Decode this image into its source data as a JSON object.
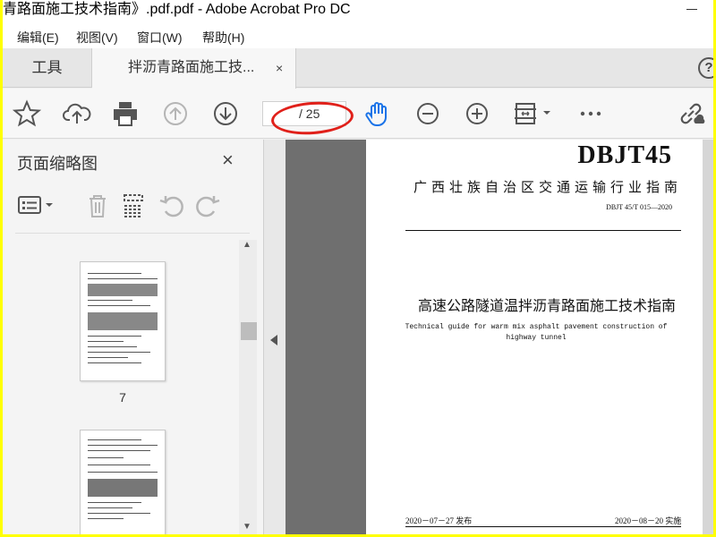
{
  "window": {
    "title": "青路面施工技术指南》.pdf.pdf - Adobe Acrobat Pro DC"
  },
  "menu": [
    "编辑(E)",
    "视图(V)",
    "窗口(W)",
    "帮助(H)"
  ],
  "tabs": {
    "tools": "工具",
    "document": "拌沥青路面施工技...",
    "close": "×",
    "help": "?"
  },
  "toolbar": {
    "page_current": "",
    "page_total": "/ 25",
    "icons": [
      "star-icon",
      "upload-icon",
      "print-icon",
      "page-up-icon",
      "page-down-icon",
      "hand-icon",
      "zoom-out-icon",
      "zoom-in-icon",
      "fit-page-icon",
      "more-icon",
      "share-link-icon"
    ],
    "accent": "#1a73e8",
    "highlight_color": "#e0201a"
  },
  "side_panel": {
    "title": "页面缩略图",
    "close": "×",
    "thumbnails": [
      {
        "label": "7"
      },
      {
        "label": ""
      }
    ]
  },
  "document": {
    "code": "DBJT45",
    "org": "广西壮族自治区交通运输行业指南",
    "number": "DBJT 45/T 015—2020",
    "title": "高速公路隧道温拌沥青路面施工技术指南",
    "subtitle": "Technical guide for warm mix asphalt pavement construction of highway tunnel",
    "publish": "2020－07－27 发布",
    "implement": "2020－08－20 实施"
  }
}
